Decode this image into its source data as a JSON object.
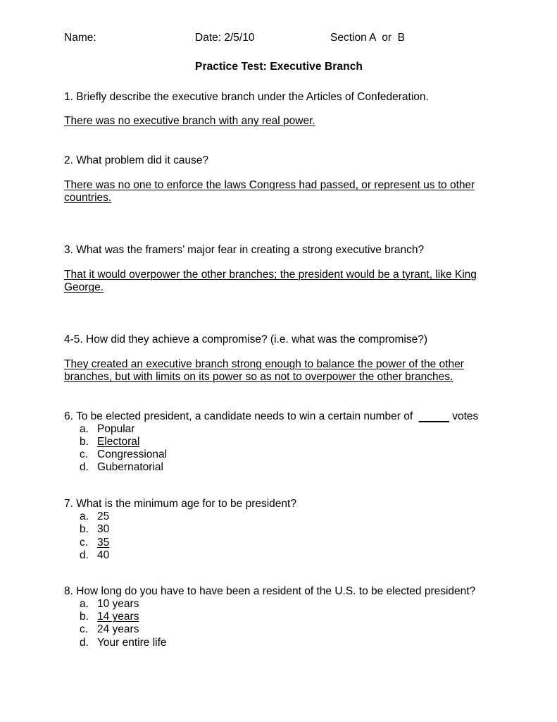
{
  "header": {
    "name_label": "Name:",
    "date_label": "Date: 2/5/10",
    "section_label": "Section A  or  B"
  },
  "title": "Practice Test: Executive Branch",
  "items": [
    {
      "number": "1",
      "question": "1. Briefly describe the executive branch under the Articles of Confederation.",
      "answer": "There was no executive branch with any real power."
    },
    {
      "number": "2",
      "question": "2. What problem did it cause?",
      "answer": "There was no one to enforce the laws Congress had passed, or represent us to other countries."
    },
    {
      "number": "3",
      "question": "3. What was the framers’ major fear in creating a strong executive branch?",
      "answer": "That it would overpower the other branches; the president would be a tyrant, like King George."
    },
    {
      "number": "4-5",
      "question": "4-5. How did they achieve a compromise? (i.e. what was the compromise?)",
      "answer": "They created an executive branch strong enough to balance the power of the other branches, but with limits on its power so as not to overpower the other branches."
    },
    {
      "number": "6",
      "question_prefix": "6. To be elected president, a candidate needs to win a certain number of  ",
      "question_blank": "_____",
      "question_suffix": " votes",
      "choices": [
        {
          "marker": "a.",
          "text": "Popular",
          "selected": false
        },
        {
          "marker": "b.",
          "text": "Electoral",
          "selected": true
        },
        {
          "marker": "c.",
          "text": "Congressional",
          "selected": false
        },
        {
          "marker": "d.",
          "text": "Gubernatorial",
          "selected": false
        }
      ]
    },
    {
      "number": "7",
      "question": "7. What is the minimum age for to be president?",
      "choices": [
        {
          "marker": "a.",
          "text": "25",
          "selected": false
        },
        {
          "marker": "b.",
          "text": "30",
          "selected": false
        },
        {
          "marker": "c.",
          "text": "35",
          "selected": true
        },
        {
          "marker": "d.",
          "text": "40",
          "selected": false
        }
      ]
    },
    {
      "number": "8",
      "question": "8. How long do you have to have been a resident of the U.S. to be elected president?",
      "choices": [
        {
          "marker": "a.",
          "text": "10 years",
          "selected": false
        },
        {
          "marker": "b.",
          "text": "14 years",
          "selected": true
        },
        {
          "marker": "c.",
          "text": "24 years",
          "selected": false
        },
        {
          "marker": "d.",
          "text": "Your entire life",
          "selected": false
        }
      ]
    }
  ]
}
